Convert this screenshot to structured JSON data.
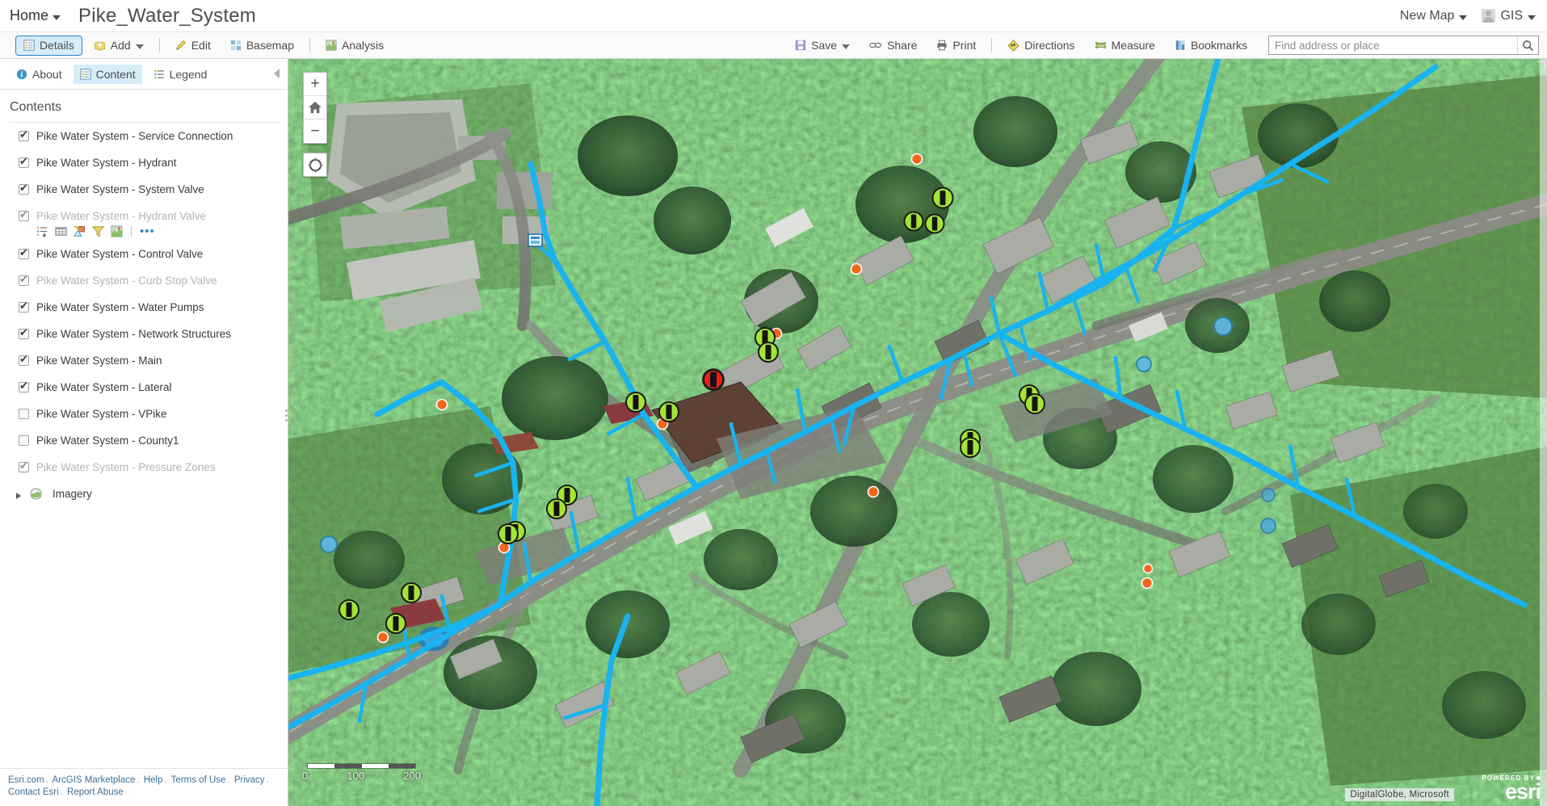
{
  "header": {
    "home_label": "Home",
    "map_title": "Pike_Water_System",
    "new_map_label": "New Map",
    "account_label": "GIS"
  },
  "toolbar": {
    "details_label": "Details",
    "add_label": "Add",
    "edit_label": "Edit",
    "basemap_label": "Basemap",
    "analysis_label": "Analysis",
    "save_label": "Save",
    "share_label": "Share",
    "print_label": "Print",
    "directions_label": "Directions",
    "measure_label": "Measure",
    "bookmarks_label": "Bookmarks",
    "search_placeholder": "Find address or place",
    "search_value": ""
  },
  "panel": {
    "tabs": [
      {
        "label": "About",
        "active": false,
        "icon": "info-icon"
      },
      {
        "label": "Content",
        "active": true,
        "icon": "content-icon"
      },
      {
        "label": "Legend",
        "active": false,
        "icon": "legend-icon"
      }
    ],
    "contents_heading": "Contents",
    "layers": [
      {
        "label": "Pike Water System - Service Connection",
        "checked": true,
        "dim": false,
        "group": false
      },
      {
        "label": "Pike Water System - Hydrant",
        "checked": true,
        "dim": false,
        "group": false
      },
      {
        "label": "Pike Water System - System Valve",
        "checked": true,
        "dim": false,
        "group": false
      },
      {
        "label": "Pike Water System - Hydrant Valve",
        "checked": true,
        "dim": true,
        "group": false,
        "show_actions": true
      },
      {
        "label": "Pike Water System - Control Valve",
        "checked": true,
        "dim": false,
        "group": false
      },
      {
        "label": "Pike Water System - Curb Stop Valve",
        "checked": true,
        "dim": true,
        "group": false
      },
      {
        "label": "Pike Water System - Water Pumps",
        "checked": true,
        "dim": false,
        "group": false
      },
      {
        "label": "Pike Water System - Network Structures",
        "checked": true,
        "dim": false,
        "group": false
      },
      {
        "label": "Pike Water System - Main",
        "checked": true,
        "dim": false,
        "group": false
      },
      {
        "label": "Pike Water System - Lateral",
        "checked": true,
        "dim": false,
        "group": false
      },
      {
        "label": "Pike Water System - VPike",
        "checked": false,
        "dim": false,
        "group": false
      },
      {
        "label": "Pike Water System - County1",
        "checked": false,
        "dim": false,
        "group": false
      },
      {
        "label": "Pike Water System - Pressure Zones",
        "checked": true,
        "dim": true,
        "group": false
      },
      {
        "label": "Imagery",
        "checked": null,
        "dim": false,
        "group": true
      }
    ],
    "layer_actions": [
      "show-legend-icon",
      "show-table-icon",
      "change-symbols-icon",
      "filter-icon",
      "perform-analysis-icon",
      "more-options-icon"
    ],
    "footer_links": [
      "Esri.com",
      "ArcGIS Marketplace",
      "Help",
      "Terms of Use",
      "Privacy",
      "Contact Esri",
      "Report Abuse"
    ]
  },
  "map": {
    "controls": [
      "zoom-in",
      "home",
      "zoom-out",
      "locate"
    ],
    "zoom_in_label": "+",
    "zoom_out_label": "−",
    "scale_ticks": [
      "0",
      "100",
      "200"
    ],
    "attribution": "DigitalGlobe, Microsoft",
    "powered_by": "POWERED BY",
    "brand": "esri",
    "colors": {
      "pipe_main": "#19b3ef",
      "valve_open": "#a4e433",
      "valve_closed": "#f01e14",
      "service_connection": "#f2671f",
      "network_structure": "#4fb3e8",
      "accent": "#2788c4"
    }
  }
}
